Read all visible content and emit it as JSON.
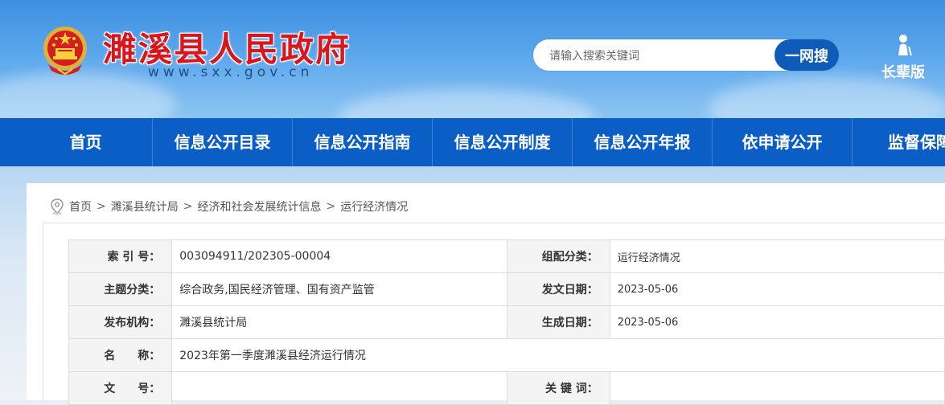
{
  "header": {
    "site_title": "濉溪县人民政府",
    "site_url": "www.sxx.gov.cn",
    "search_placeholder": "请输入搜索关键词",
    "search_button": "一网搜",
    "elder_mode_label": "长辈版"
  },
  "nav": {
    "items": [
      "首页",
      "信息公开目录",
      "信息公开指南",
      "信息公开制度",
      "信息公开年报",
      "依申请公开",
      "监督保障"
    ]
  },
  "breadcrumb": {
    "items": [
      "首页",
      "濉溪县统计局",
      "经济和社会发展统计信息",
      "运行经济情况"
    ],
    "separator": ">"
  },
  "meta": {
    "index_no_label": "索 引 号：",
    "index_no": "003094911/202305-00004",
    "category_label": "组配分类：",
    "category": "运行经济情况",
    "topic_label": "主题分类：",
    "topic": "综合政务,国民经济管理、国有资产监管",
    "issue_date_label": "发文日期：",
    "issue_date": "2023-05-06",
    "publisher_label": "发布机构：",
    "publisher": "濉溪县统计局",
    "create_date_label": "生成日期：",
    "create_date": "2023-05-06",
    "name_label": "名　　称：",
    "name": "2023年第一季度濉溪县经济运行情况",
    "doc_no_label": "文　　号：",
    "doc_no": "",
    "keywords_label": "关 键 词：",
    "keywords": ""
  },
  "colors": {
    "title_red": "#d9161c",
    "nav_blue": "#0b5ec6",
    "button_blue": "#0e5bb8"
  }
}
